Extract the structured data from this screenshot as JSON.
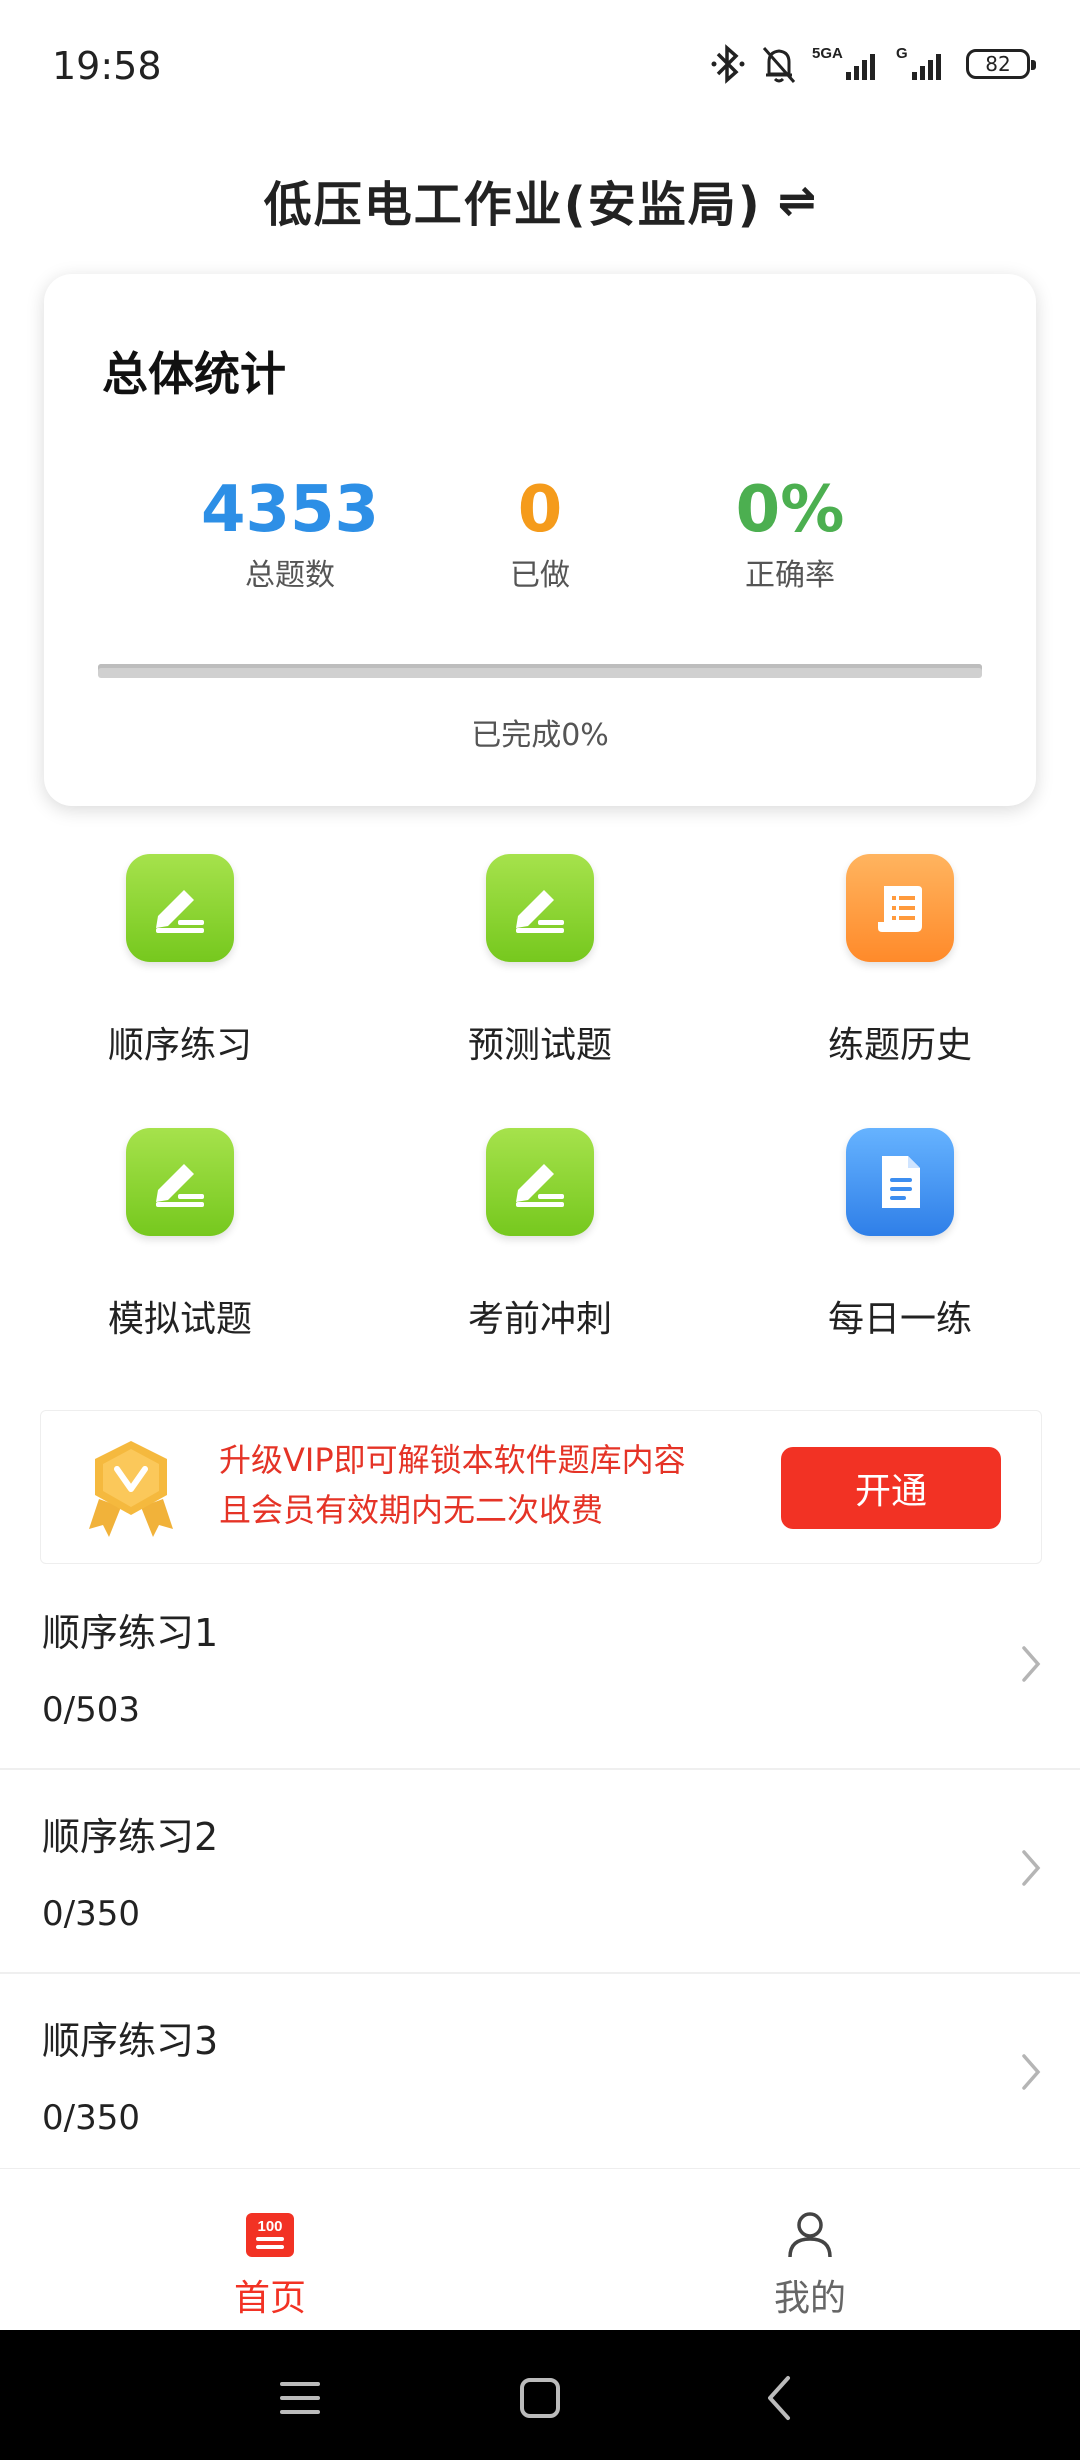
{
  "status_bar": {
    "time": "19:58",
    "battery": "82"
  },
  "header": {
    "title": "低压电工作业(安监局)",
    "swap_icon": "⇌"
  },
  "stats": {
    "title": "总体统计",
    "total": {
      "value": "4353",
      "label": "总题数",
      "color": "#2d8fe6"
    },
    "done": {
      "value": "0",
      "label": "已做",
      "color": "#f59b1b"
    },
    "accuracy": {
      "value": "0%",
      "label": "正确率",
      "color": "#4caf50"
    },
    "progress_text": "已完成0%",
    "progress_fraction": 0
  },
  "grid": [
    {
      "label": "顺序练习",
      "icon": "edit-icon",
      "color": "green"
    },
    {
      "label": "预测试题",
      "icon": "edit-icon",
      "color": "green"
    },
    {
      "label": "练题历史",
      "icon": "scroll-icon",
      "color": "orange"
    },
    {
      "label": "模拟试题",
      "icon": "edit-icon",
      "color": "green"
    },
    {
      "label": "考前冲刺",
      "icon": "edit-icon",
      "color": "green"
    },
    {
      "label": "每日一练",
      "icon": "document-icon",
      "color": "blue"
    }
  ],
  "vip": {
    "line1": "升级VIP即可解锁本软件题库内容",
    "line2": "且会员有效期内无二次收费",
    "button": "开通"
  },
  "list": [
    {
      "title": "顺序练习1",
      "progress": "0/503"
    },
    {
      "title": "顺序练习2",
      "progress": "0/350"
    },
    {
      "title": "顺序练习3",
      "progress": "0/350"
    }
  ],
  "bottom_nav": {
    "home": {
      "label": "首页",
      "badge": "100",
      "active_color": "#f23224"
    },
    "mine": {
      "label": "我的"
    }
  }
}
